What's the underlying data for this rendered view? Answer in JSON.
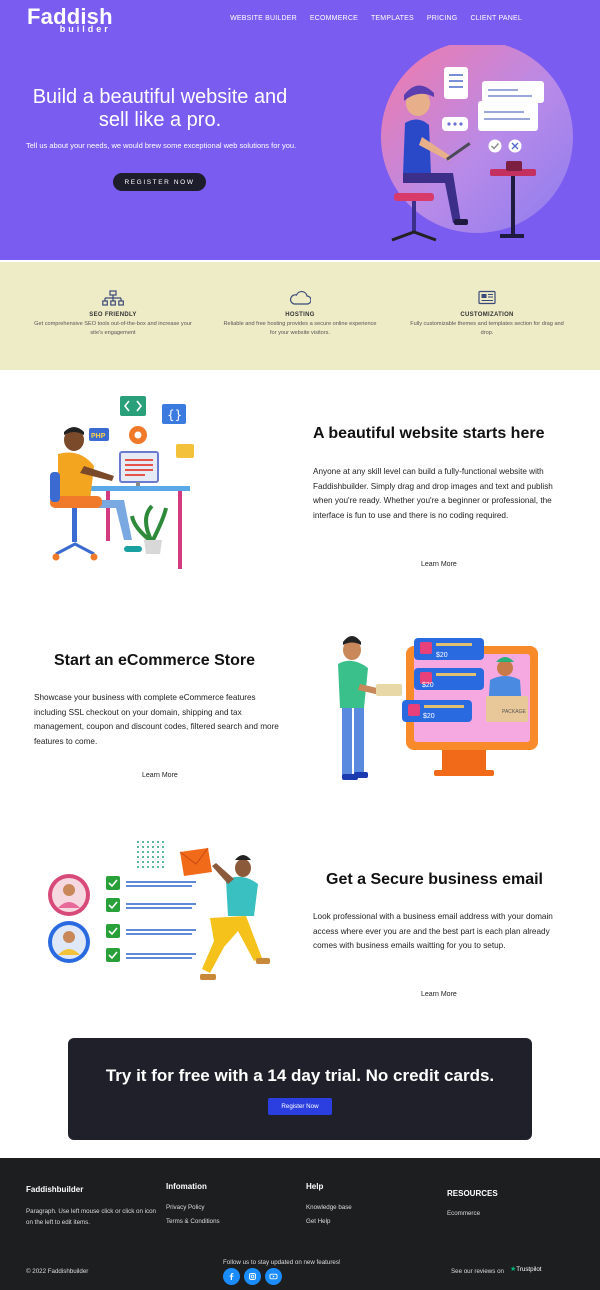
{
  "brand": {
    "name": "Faddish",
    "sub": "builder"
  },
  "nav": [
    "WEBSITE BUILDER",
    "ECOMMERCE",
    "TEMPLATES",
    "PRICING",
    "CLIENT PANEL"
  ],
  "hero": {
    "title": "Build a beautiful website and sell like a pro.",
    "subtitle": "Tell us about your needs, we would brew some exceptional web solutions for you.",
    "cta": "REGISTER NOW"
  },
  "features": [
    {
      "title": "SEO FRIENDLY",
      "desc": "Get comprehensive SEO tools out-of-the-box and increase your site's engagement",
      "icon": "sitemap-icon"
    },
    {
      "title": "HOSTING",
      "desc": "Reliable and free hosting provides a secure online experience for your website visitors.",
      "icon": "cloud-icon"
    },
    {
      "title": "CUSTOMIZATION",
      "desc": "Fully customizable themes and templates section for drag and drop.",
      "icon": "layout-icon"
    }
  ],
  "sections": [
    {
      "title": "A beautiful website starts here",
      "text": "Anyone at any skill level can build a fully-functional website with Faddishbuilder. Simply drag and drop images and text and publish when you're ready. Whether you're a beginner or professional, the interface is fun to use and there is no coding required.",
      "link": "Learn More"
    },
    {
      "title": "Start an eCommerce Store",
      "text": "Showcase your business with complete eCommerce features including SSL checkout on your domain, shipping and tax management, coupon and discount codes, filtered search and more features to come.",
      "link": "Learn More"
    },
    {
      "title": "Get a Secure business email",
      "text": "Look professional with a business email address with your domain access where ever you are and the best part is each plan already comes with business emails waitting for you to setup.",
      "link": "Learn More"
    }
  ],
  "shop_prices": [
    "$20",
    "$20",
    "$20"
  ],
  "package_label": "PACKAGE",
  "php_label": "PHP",
  "cta": {
    "title": "Try it for free with a 14 day trial. No credit cards.",
    "button": "Register Now"
  },
  "footer": {
    "brand": "Faddishbuilder",
    "brand_text": "Paragraph. Use left mouse click or click on icon on the left to edit items.",
    "info_head": "Infomation",
    "info_links": [
      "Privacy Policy",
      "Terms & Conditions"
    ],
    "help_head": "Help",
    "help_links": [
      "Knowledge base",
      "Get Help"
    ],
    "res_head": "RESOURCES",
    "res_links": [
      "Ecommerce"
    ],
    "copyright": "© 2022 Faddishbuilder",
    "follow": "Follow us to stay updated on new features!",
    "reviews": "See our reviews on",
    "trustpilot": "Trustpilot"
  },
  "colors": {
    "hero_bg": "#7b5cf0",
    "features_bg": "#eeebc7",
    "cta_bg": "#1f2029",
    "button_blue": "#2b3fe0",
    "footer_bg": "#1d1e1f"
  }
}
